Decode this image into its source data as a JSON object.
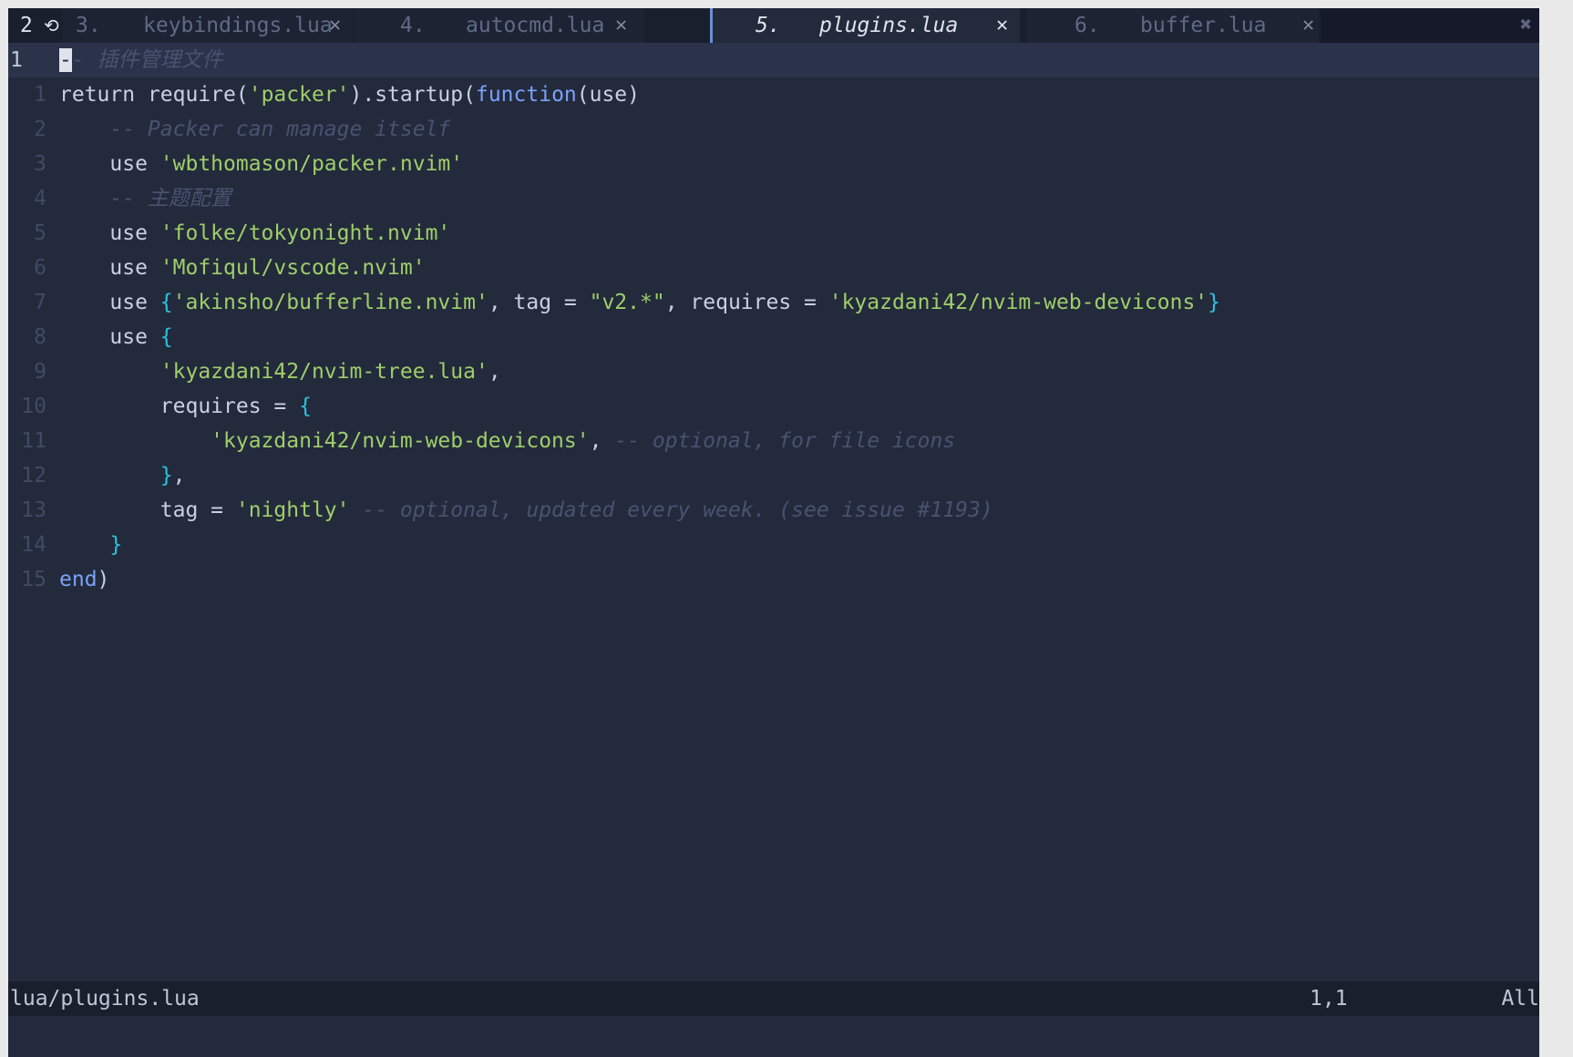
{
  "tabline": {
    "buffer_count": "2",
    "scroll_indicator": "⟲",
    "close_all": "✖",
    "tabs": [
      {
        "num": "3.",
        "name": "keybindings.lua",
        "icon": "",
        "close": "✕",
        "active": false
      },
      {
        "num": "4.",
        "name": "autocmd.lua",
        "icon": "",
        "close": "✕",
        "active": false
      },
      {
        "num": "5.",
        "name": "plugins.lua",
        "icon": "",
        "close": "✕",
        "active": true
      },
      {
        "num": "6.",
        "name": "buffer.lua",
        "icon": "",
        "close": "✕",
        "active": false
      }
    ]
  },
  "editor": {
    "current_line_number": "1",
    "cursor_char": "-",
    "lines": [
      {
        "num": "1",
        "segments": [
          [
            "com",
            "- 插件管理文件"
          ]
        ]
      },
      {
        "num": "1",
        "segments": [
          [
            "kw",
            "return "
          ],
          [
            "pl",
            "require("
          ],
          [
            "str",
            "'packer'"
          ],
          [
            "pl",
            ").startup("
          ],
          [
            "fn",
            "function"
          ],
          [
            "pl",
            "(use)"
          ]
        ]
      },
      {
        "num": "2",
        "segments": [
          [
            "com",
            "    -- Packer can manage itself"
          ]
        ]
      },
      {
        "num": "3",
        "segments": [
          [
            "pl",
            "    use "
          ],
          [
            "str",
            "'wbthomason/packer.nvim'"
          ]
        ]
      },
      {
        "num": "4",
        "segments": [
          [
            "com",
            "    -- 主题配置"
          ]
        ]
      },
      {
        "num": "5",
        "segments": [
          [
            "pl",
            "    use "
          ],
          [
            "str",
            "'folke/tokyonight.nvim'"
          ]
        ]
      },
      {
        "num": "6",
        "segments": [
          [
            "pl",
            "    use "
          ],
          [
            "str",
            "'Mofiqul/vscode.nvim'"
          ]
        ]
      },
      {
        "num": "7",
        "segments": [
          [
            "pl",
            "    use "
          ],
          [
            "br",
            "{"
          ],
          [
            "str",
            "'akinsho/bufferline.nvim'"
          ],
          [
            "pl",
            ", tag = "
          ],
          [
            "str",
            "\"v2.*\""
          ],
          [
            "pl",
            ", requires = "
          ],
          [
            "str",
            "'kyazdani42/nvim-web-devicons'"
          ],
          [
            "br",
            "}"
          ]
        ]
      },
      {
        "num": "8",
        "segments": [
          [
            "pl",
            "    use "
          ],
          [
            "br",
            "{"
          ]
        ]
      },
      {
        "num": "9",
        "segments": [
          [
            "pl",
            "        "
          ],
          [
            "str",
            "'kyazdani42/nvim-tree.lua'"
          ],
          [
            "pl",
            ","
          ]
        ]
      },
      {
        "num": "10",
        "segments": [
          [
            "pl",
            "        requires = "
          ],
          [
            "br",
            "{"
          ]
        ]
      },
      {
        "num": "11",
        "segments": [
          [
            "pl",
            "            "
          ],
          [
            "str",
            "'kyazdani42/nvim-web-devicons'"
          ],
          [
            "pl",
            ", "
          ],
          [
            "com",
            "-- optional, for file icons"
          ]
        ]
      },
      {
        "num": "12",
        "segments": [
          [
            "pl",
            "        "
          ],
          [
            "br",
            "}"
          ],
          [
            "pl",
            ","
          ]
        ]
      },
      {
        "num": "13",
        "segments": [
          [
            "pl",
            "        tag = "
          ],
          [
            "str",
            "'nightly'"
          ],
          [
            "pl",
            " "
          ],
          [
            "com",
            "-- optional, updated every week. (see issue #1193)"
          ]
        ]
      },
      {
        "num": "14",
        "segments": [
          [
            "pl",
            "    "
          ],
          [
            "br",
            "}"
          ]
        ]
      },
      {
        "num": "15",
        "segments": [
          [
            "fn",
            "end"
          ],
          [
            "pl",
            ")"
          ]
        ]
      }
    ]
  },
  "statusline": {
    "file": "lua/plugins.lua",
    "position": "1,1",
    "percent": "All"
  },
  "colors": {
    "background": "#232a3c",
    "string": "#9ece6a",
    "function": "#7aa2f7",
    "bracket": "#2ac3de",
    "comment": "#4a5270"
  }
}
